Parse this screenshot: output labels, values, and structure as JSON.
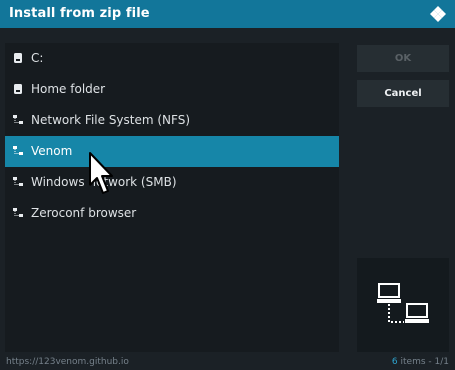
{
  "window": {
    "title": "Install from zip file"
  },
  "list": {
    "items": [
      {
        "label": "C:",
        "icon": "drive-icon",
        "selected": false
      },
      {
        "label": "Home folder",
        "icon": "drive-icon",
        "selected": false
      },
      {
        "label": "Network File System (NFS)",
        "icon": "network-share-icon",
        "selected": false
      },
      {
        "label": "Venom",
        "icon": "network-share-icon",
        "selected": true
      },
      {
        "label": "Windows network (SMB)",
        "icon": "network-share-icon",
        "selected": false
      },
      {
        "label": "Zeroconf browser",
        "icon": "network-share-icon",
        "selected": false
      }
    ]
  },
  "buttons": {
    "ok_label": "OK",
    "cancel_label": "Cancel"
  },
  "status": {
    "path": "https://123venom.github.io",
    "count": "6",
    "items_text": " items - 1/1"
  },
  "colors": {
    "accent": "#12769a",
    "selected": "#1686a8",
    "background": "#1b2126"
  }
}
